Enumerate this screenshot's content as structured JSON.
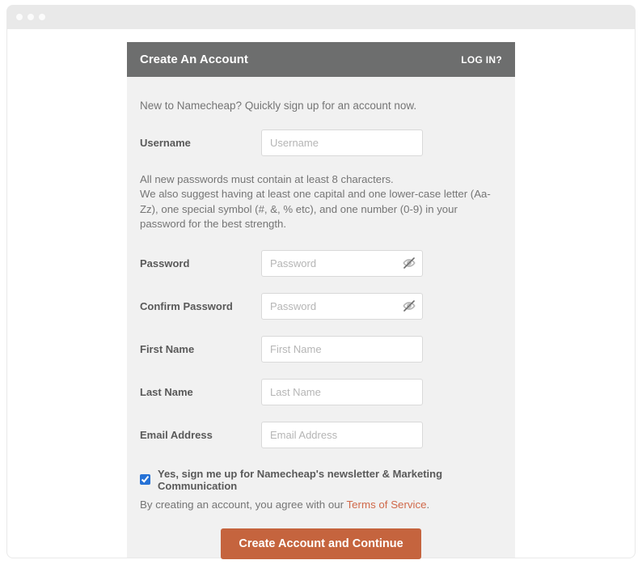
{
  "header": {
    "title": "Create An Account",
    "login_link": "LOG IN?"
  },
  "intro_text": "New to Namecheap? Quickly sign up for an account now.",
  "fields": {
    "username": {
      "label": "Username",
      "placeholder": "Username"
    },
    "password": {
      "label": "Password",
      "placeholder": "Password"
    },
    "confirm_password": {
      "label": "Confirm Password",
      "placeholder": "Password"
    },
    "first_name": {
      "label": "First Name",
      "placeholder": "First Name"
    },
    "last_name": {
      "label": "Last Name",
      "placeholder": "Last Name"
    },
    "email": {
      "label": "Email Address",
      "placeholder": "Email Address"
    }
  },
  "password_help": "All new passwords must contain at least 8 characters.\nWe also suggest having at least one capital and one lower-case letter (Aa-Zz), one special symbol (#, &, % etc), and one number (0-9) in your password for the best strength.",
  "newsletter": {
    "checked": true,
    "label": "Yes, sign me up for Namecheap's newsletter & Marketing Communication"
  },
  "terms": {
    "prefix": "By creating an account, you agree with our ",
    "link_text": "Terms of Service",
    "suffix": "."
  },
  "submit_label": "Create Account and Continue"
}
